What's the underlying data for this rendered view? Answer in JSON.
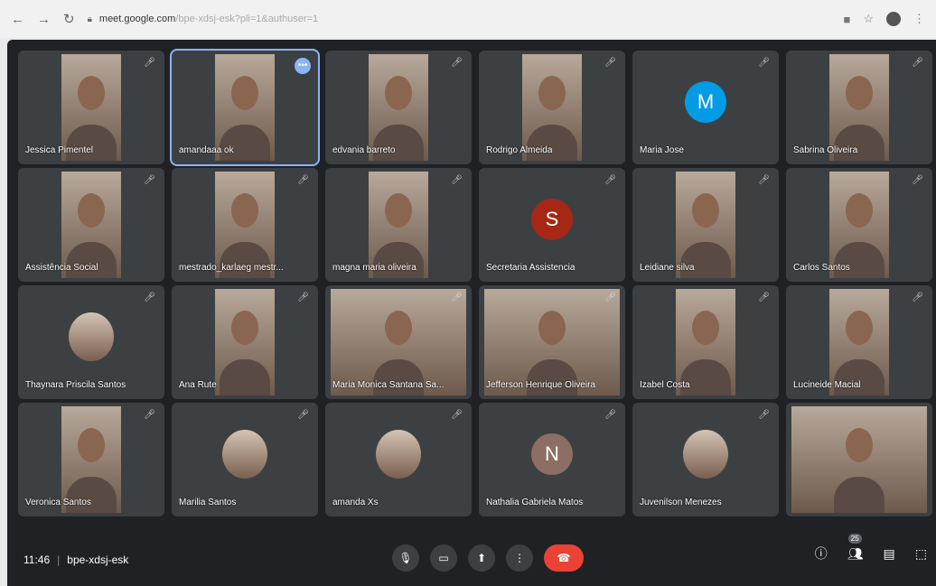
{
  "browser": {
    "url_domain": "meet.google.com",
    "url_path": "/bpe-xdsj-esk?pli=1&authuser=1"
  },
  "participants": [
    {
      "name": "Jessica Pimentel",
      "kind": "photo"
    },
    {
      "name": "amandaaa ok",
      "kind": "photo"
    },
    {
      "name": "edvania barreto",
      "kind": "photo"
    },
    {
      "name": "Rodrigo Almeida",
      "kind": "photo"
    },
    {
      "name": "Maria Jose",
      "kind": "avatar",
      "initial": "M",
      "color": "#039be5"
    },
    {
      "name": "Sabrina Oliveira",
      "kind": "photo"
    },
    {
      "name": "Assistência Social",
      "kind": "photo"
    },
    {
      "name": "mestrado_karlaeg mestr...",
      "kind": "photo"
    },
    {
      "name": "magna maria oliveira",
      "kind": "photo"
    },
    {
      "name": "Secretaria Assistencia",
      "kind": "avatar",
      "initial": "S",
      "color": "#a52714"
    },
    {
      "name": "Leidiane silva",
      "kind": "photo"
    },
    {
      "name": "Carlos Santos",
      "kind": "photo"
    },
    {
      "name": "Thaynara Priscila Santos",
      "kind": "circle"
    },
    {
      "name": "Ana Rute",
      "kind": "photo"
    },
    {
      "name": "Maria Monica Santana Sa...",
      "kind": "wide"
    },
    {
      "name": "Jefferson Henrique Oliveira",
      "kind": "wide"
    },
    {
      "name": "Izabel Costa",
      "kind": "photo"
    },
    {
      "name": "Lucineide Macial",
      "kind": "photo"
    },
    {
      "name": "Veronica Santos",
      "kind": "photo"
    },
    {
      "name": "Marilia Santos",
      "kind": "circle"
    },
    {
      "name": "amanda Xs",
      "kind": "circle"
    },
    {
      "name": "Nathalia Gabriela Matos",
      "kind": "avatar",
      "initial": "N",
      "color": "#8d6e63"
    },
    {
      "name": "Juvenilson Menezes",
      "kind": "circle"
    },
    {
      "name": "",
      "kind": "wide"
    }
  ],
  "meeting": {
    "time": "11:46",
    "code": "bpe-xdsj-esk",
    "participant_count": "25"
  }
}
